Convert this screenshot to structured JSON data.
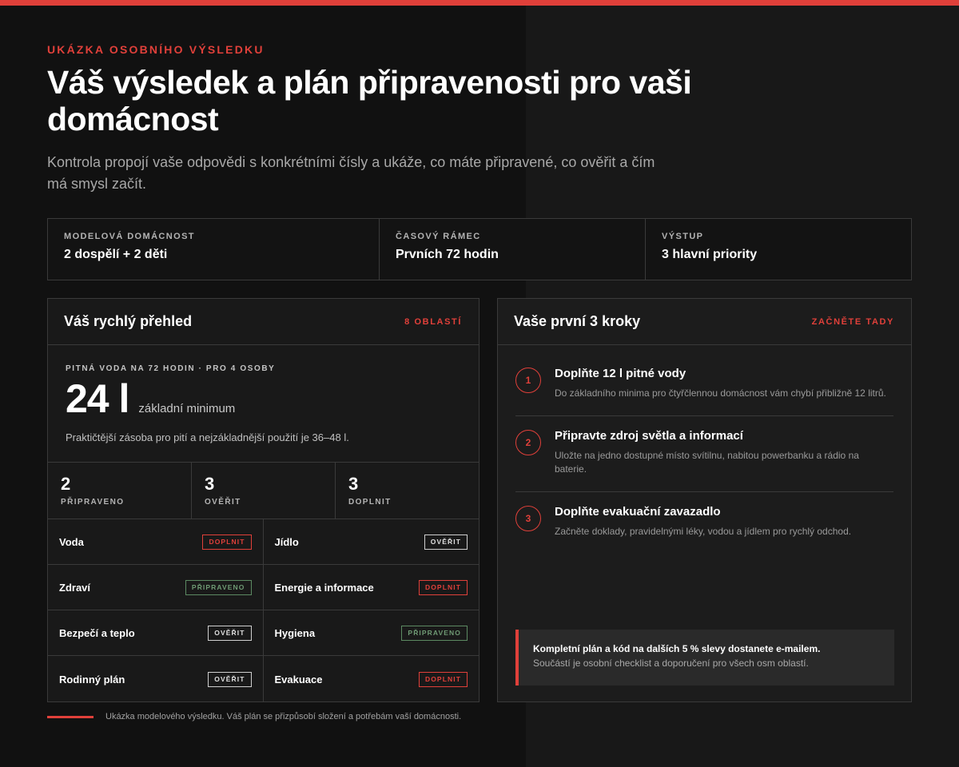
{
  "eyebrow": "UKÁZKA OSOBNÍHO VÝSLEDKU",
  "title": "Váš výsledek a plán připravenosti pro vaši domácnost",
  "subtitle": "Kontrola propojí vaše odpovědi s konkrétními čísly a ukáže, co máte připravené, co ověřit a čím má smysl začít.",
  "meta": [
    {
      "label": "MODELOVÁ DOMÁCNOST",
      "value": "2 dospělí + 2 děti"
    },
    {
      "label": "ČASOVÝ RÁMEC",
      "value": "Prvních 72 hodin"
    },
    {
      "label": "VÝSTUP",
      "value": "3 hlavní priority"
    }
  ],
  "overview": {
    "title": "Váš rychlý přehled",
    "tag": "8 OBLASTÍ",
    "water": {
      "label": "PITNÁ VODA NA 72 HODIN · PRO 4 OSOBY",
      "amount": "24 l",
      "amount_sub": "základní minimum",
      "note": "Praktičtější zásoba pro pití a nejzákladnější použití je 36–48 l."
    },
    "stats": [
      {
        "value": "2",
        "label": "PŘIPRAVENO"
      },
      {
        "value": "3",
        "label": "OVĚŘIT"
      },
      {
        "value": "3",
        "label": "DOPLNIT"
      }
    ],
    "areas": [
      {
        "name": "Voda",
        "status": "DOPLNIT"
      },
      {
        "name": "Jídlo",
        "status": "OVĚŘIT"
      },
      {
        "name": "Zdraví",
        "status": "PŘIPRAVENO"
      },
      {
        "name": "Energie a informace",
        "status": "DOPLNIT"
      },
      {
        "name": "Bezpečí a teplo",
        "status": "OVĚŘIT"
      },
      {
        "name": "Hygiena",
        "status": "PŘIPRAVENO"
      },
      {
        "name": "Rodinný plán",
        "status": "OVĚŘIT"
      },
      {
        "name": "Evakuace",
        "status": "DOPLNIT"
      }
    ]
  },
  "footnote": "Ukázka modelového výsledku. Váš plán se přizpůsobí složení a potřebám vaší domácnosti.",
  "steps_card": {
    "title": "Vaše první 3 kroky",
    "tag": "ZAČNĚTE TADY",
    "steps": [
      {
        "num": "1",
        "title": "Doplňte 12 l pitné vody",
        "text": "Do základního minima pro čtyřčlennou domácnost vám chybí přibližně 12 litrů."
      },
      {
        "num": "2",
        "title": "Připravte zdroj světla a informací",
        "text": "Uložte na jedno dostupné místo svítilnu, nabitou powerbanku a rádio na baterie."
      },
      {
        "num": "3",
        "title": "Doplňte evakuační zavazadlo",
        "text": "Začněte doklady, pravidelnými léky, vodou a jídlem pro rychlý odchod."
      }
    ],
    "promo": {
      "line1": "Kompletní plán a kód na dalších 5 % slevy dostanete e-mailem.",
      "line2": "Součástí je osobní checklist a doporučení pro všech osm oblastí."
    }
  },
  "colors": {
    "accent": "#e0403a",
    "ready": "#5c8a62",
    "background": "#141414"
  }
}
